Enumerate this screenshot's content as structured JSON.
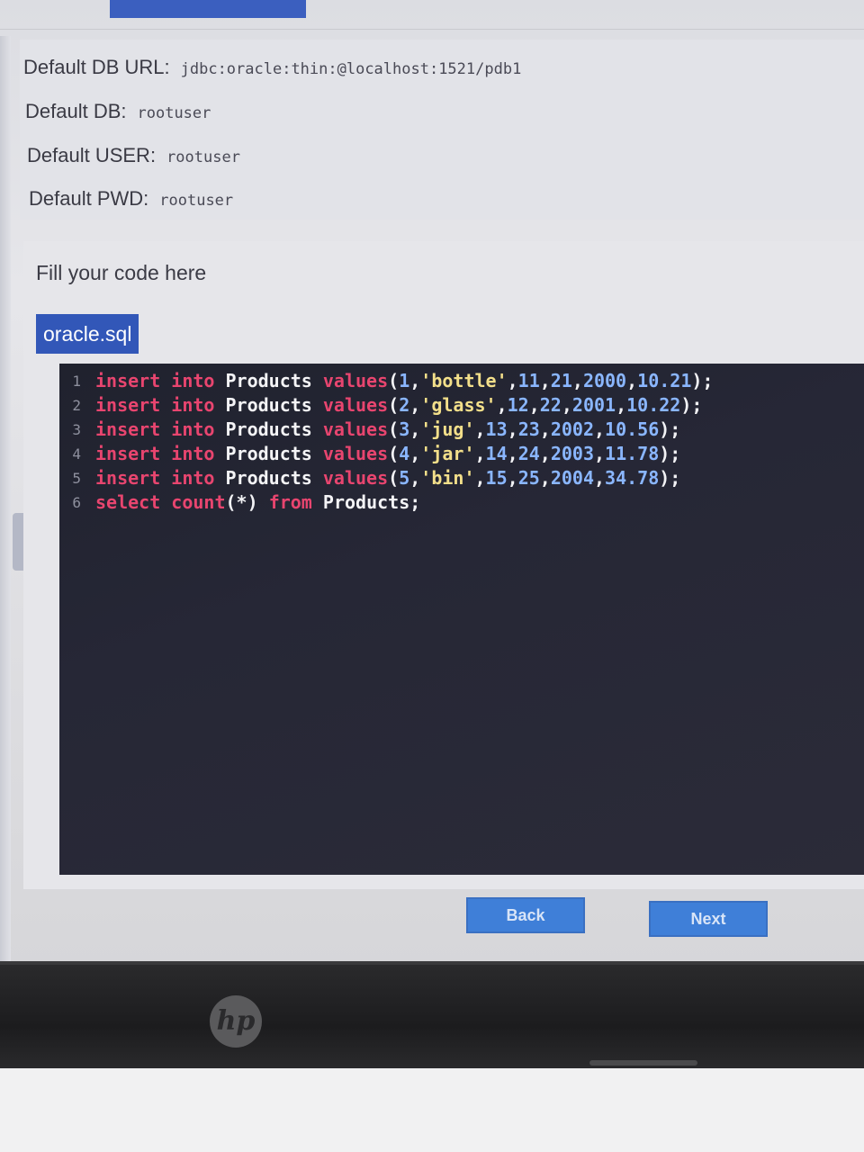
{
  "config": {
    "db_url_label": "Default DB URL:",
    "db_url_value": "jdbc:oracle:thin:@localhost:1521/pdb1",
    "db_label": "Default DB:",
    "db_value": "rootuser",
    "user_label": "Default USER:",
    "user_value": "rootuser",
    "pwd_label": "Default PWD:",
    "pwd_value": "rootuser"
  },
  "editor": {
    "prompt": "Fill your code here",
    "file_tab": "oracle.sql",
    "line_numbers": [
      "1",
      "2",
      "3",
      "4",
      "5",
      "6"
    ],
    "lines": [
      [
        {
          "t": "insert",
          "c": "kw"
        },
        {
          "t": " ",
          "c": "pun"
        },
        {
          "t": "into",
          "c": "kw"
        },
        {
          "t": " ",
          "c": "pun"
        },
        {
          "t": "Products",
          "c": "tbl"
        },
        {
          "t": " ",
          "c": "pun"
        },
        {
          "t": "values",
          "c": "fn"
        },
        {
          "t": "(",
          "c": "pun"
        },
        {
          "t": "1",
          "c": "num"
        },
        {
          "t": ",",
          "c": "pun"
        },
        {
          "t": "'bottle'",
          "c": "str"
        },
        {
          "t": ",",
          "c": "pun"
        },
        {
          "t": "11",
          "c": "num"
        },
        {
          "t": ",",
          "c": "pun"
        },
        {
          "t": "21",
          "c": "num"
        },
        {
          "t": ",",
          "c": "pun"
        },
        {
          "t": "2000",
          "c": "num"
        },
        {
          "t": ",",
          "c": "pun"
        },
        {
          "t": "10.21",
          "c": "num"
        },
        {
          "t": ");",
          "c": "pun"
        }
      ],
      [
        {
          "t": "insert",
          "c": "kw"
        },
        {
          "t": " ",
          "c": "pun"
        },
        {
          "t": "into",
          "c": "kw"
        },
        {
          "t": " ",
          "c": "pun"
        },
        {
          "t": "Products",
          "c": "tbl"
        },
        {
          "t": " ",
          "c": "pun"
        },
        {
          "t": "values",
          "c": "fn"
        },
        {
          "t": "(",
          "c": "pun"
        },
        {
          "t": "2",
          "c": "num"
        },
        {
          "t": ",",
          "c": "pun"
        },
        {
          "t": "'glass'",
          "c": "str"
        },
        {
          "t": ",",
          "c": "pun"
        },
        {
          "t": "12",
          "c": "num"
        },
        {
          "t": ",",
          "c": "pun"
        },
        {
          "t": "22",
          "c": "num"
        },
        {
          "t": ",",
          "c": "pun"
        },
        {
          "t": "2001",
          "c": "num"
        },
        {
          "t": ",",
          "c": "pun"
        },
        {
          "t": "10.22",
          "c": "num"
        },
        {
          "t": ");",
          "c": "pun"
        }
      ],
      [
        {
          "t": "insert",
          "c": "kw"
        },
        {
          "t": " ",
          "c": "pun"
        },
        {
          "t": "into",
          "c": "kw"
        },
        {
          "t": " ",
          "c": "pun"
        },
        {
          "t": "Products",
          "c": "tbl"
        },
        {
          "t": " ",
          "c": "pun"
        },
        {
          "t": "values",
          "c": "fn"
        },
        {
          "t": "(",
          "c": "pun"
        },
        {
          "t": "3",
          "c": "num"
        },
        {
          "t": ",",
          "c": "pun"
        },
        {
          "t": "'jug'",
          "c": "str"
        },
        {
          "t": ",",
          "c": "pun"
        },
        {
          "t": "13",
          "c": "num"
        },
        {
          "t": ",",
          "c": "pun"
        },
        {
          "t": "23",
          "c": "num"
        },
        {
          "t": ",",
          "c": "pun"
        },
        {
          "t": "2002",
          "c": "num"
        },
        {
          "t": ",",
          "c": "pun"
        },
        {
          "t": "10.56",
          "c": "num"
        },
        {
          "t": ");",
          "c": "pun"
        }
      ],
      [
        {
          "t": "insert",
          "c": "kw"
        },
        {
          "t": " ",
          "c": "pun"
        },
        {
          "t": "into",
          "c": "kw"
        },
        {
          "t": " ",
          "c": "pun"
        },
        {
          "t": "Products",
          "c": "tbl"
        },
        {
          "t": " ",
          "c": "pun"
        },
        {
          "t": "values",
          "c": "fn"
        },
        {
          "t": "(",
          "c": "pun"
        },
        {
          "t": "4",
          "c": "num"
        },
        {
          "t": ",",
          "c": "pun"
        },
        {
          "t": "'jar'",
          "c": "str"
        },
        {
          "t": ",",
          "c": "pun"
        },
        {
          "t": "14",
          "c": "num"
        },
        {
          "t": ",",
          "c": "pun"
        },
        {
          "t": "24",
          "c": "num"
        },
        {
          "t": ",",
          "c": "pun"
        },
        {
          "t": "2003",
          "c": "num"
        },
        {
          "t": ",",
          "c": "pun"
        },
        {
          "t": "11.78",
          "c": "num"
        },
        {
          "t": ");",
          "c": "pun"
        }
      ],
      [
        {
          "t": "insert",
          "c": "kw"
        },
        {
          "t": " ",
          "c": "pun"
        },
        {
          "t": "into",
          "c": "kw"
        },
        {
          "t": " ",
          "c": "pun"
        },
        {
          "t": "Products",
          "c": "tbl"
        },
        {
          "t": " ",
          "c": "pun"
        },
        {
          "t": "values",
          "c": "fn"
        },
        {
          "t": "(",
          "c": "pun"
        },
        {
          "t": "5",
          "c": "num"
        },
        {
          "t": ",",
          "c": "pun"
        },
        {
          "t": "'bin'",
          "c": "str"
        },
        {
          "t": ",",
          "c": "pun"
        },
        {
          "t": "15",
          "c": "num"
        },
        {
          "t": ",",
          "c": "pun"
        },
        {
          "t": "25",
          "c": "num"
        },
        {
          "t": ",",
          "c": "pun"
        },
        {
          "t": "2004",
          "c": "num"
        },
        {
          "t": ",",
          "c": "pun"
        },
        {
          "t": "34.78",
          "c": "num"
        },
        {
          "t": ");",
          "c": "pun"
        }
      ],
      [
        {
          "t": "select",
          "c": "kw"
        },
        {
          "t": " ",
          "c": "pun"
        },
        {
          "t": "count",
          "c": "fn"
        },
        {
          "t": "(*)",
          "c": "pun"
        },
        {
          "t": " ",
          "c": "pun"
        },
        {
          "t": "from",
          "c": "kw"
        },
        {
          "t": " ",
          "c": "pun"
        },
        {
          "t": "Products",
          "c": "tbl"
        },
        {
          "t": ";",
          "c": "pun"
        }
      ]
    ]
  },
  "buttons": {
    "back_label": "Back",
    "next_label": "Next"
  },
  "device": {
    "logo_text": "hp"
  }
}
